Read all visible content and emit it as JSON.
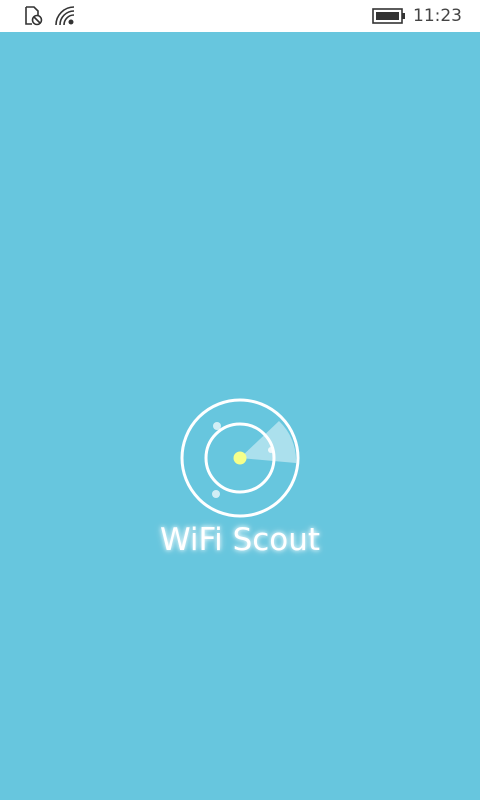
{
  "status_bar": {
    "time": "11:23",
    "icons": [
      "notification-off-icon",
      "wifi-signal-icon",
      "battery-icon"
    ]
  },
  "splash": {
    "background_color": "#67C6DE",
    "title": "WiFi Scout",
    "logo_icon": "radar-icon",
    "accent_color": "#F5FF8A"
  }
}
